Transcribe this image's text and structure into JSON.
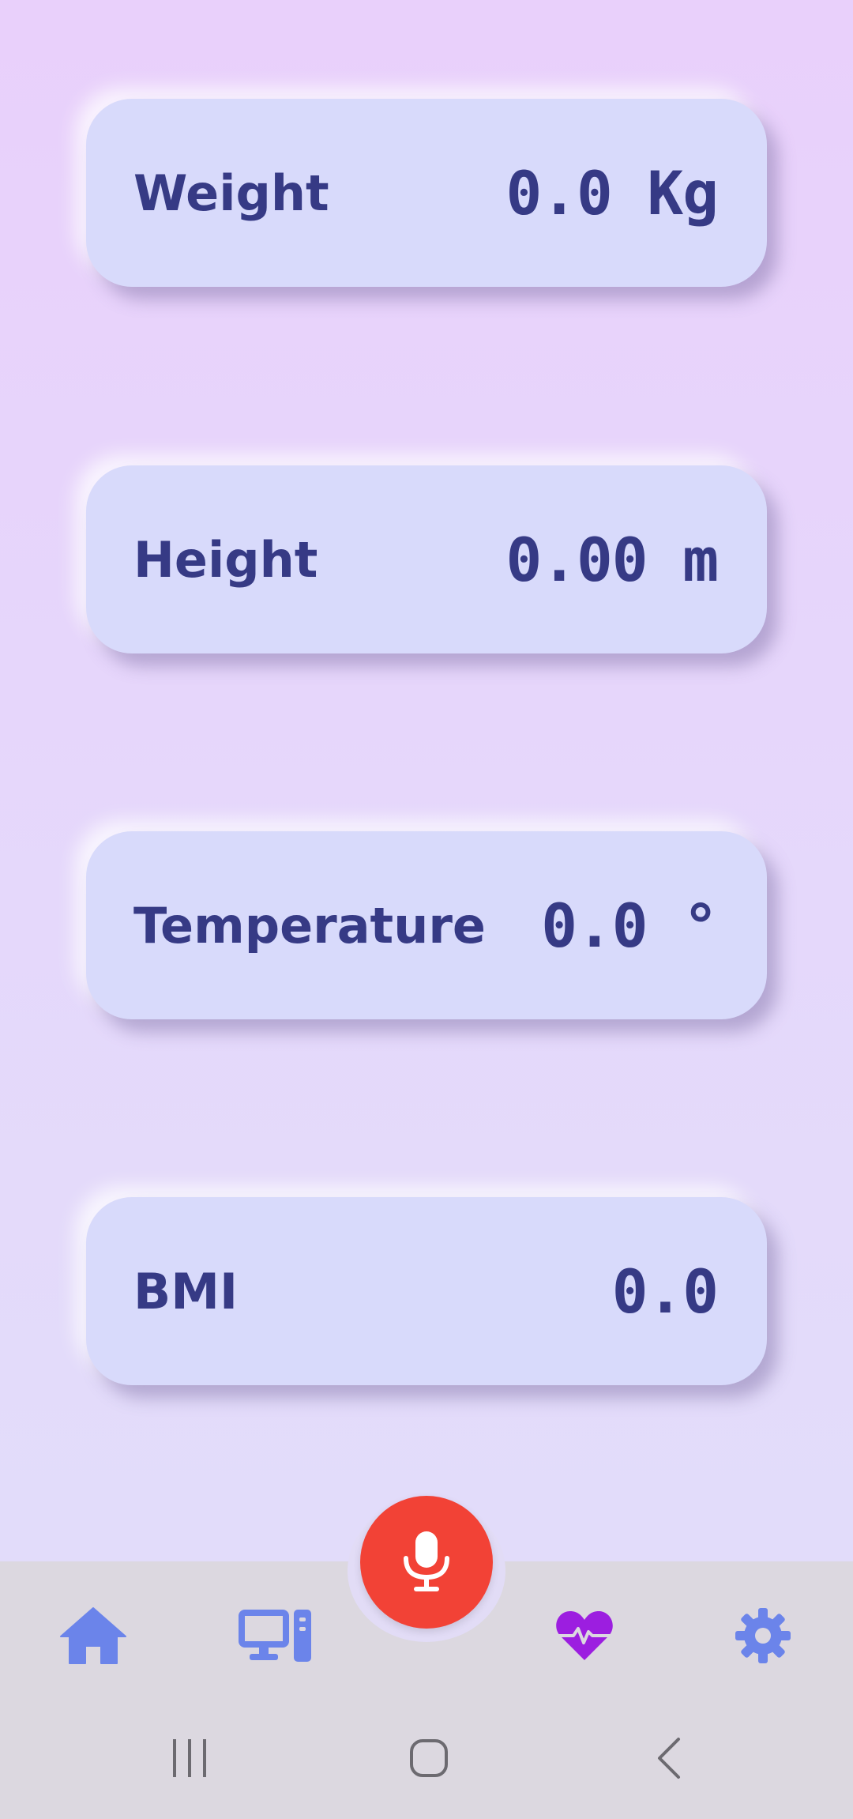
{
  "cards": [
    {
      "label": "Weight",
      "value": "0.0 Kg"
    },
    {
      "label": "Height",
      "value": "0.00 m"
    },
    {
      "label": "Temperature",
      "value": "0.0 °"
    },
    {
      "label": "BMI",
      "value": "0.0"
    }
  ],
  "fab": {
    "icon": "microphone-icon",
    "color": "#f24236"
  },
  "bottom_nav": {
    "items": [
      {
        "icon": "home-icon",
        "color": "#6b84ea"
      },
      {
        "icon": "desktop-computer-icon",
        "color": "#6b84ea"
      },
      {
        "icon": "heart-pulse-icon",
        "color": "#9c1ee0",
        "selected": true
      },
      {
        "icon": "gear-icon",
        "color": "#6b84ea"
      }
    ]
  },
  "system_nav": {
    "items": [
      {
        "icon": "recent-apps-icon"
      },
      {
        "icon": "home-circle-icon"
      },
      {
        "icon": "back-icon"
      }
    ]
  },
  "colors": {
    "card_background": "#d8dafb",
    "text": "#363a85",
    "nav_background": "#dcd8e0",
    "accent_active": "#9c1ee0",
    "accent_inactive": "#6b84ea"
  }
}
